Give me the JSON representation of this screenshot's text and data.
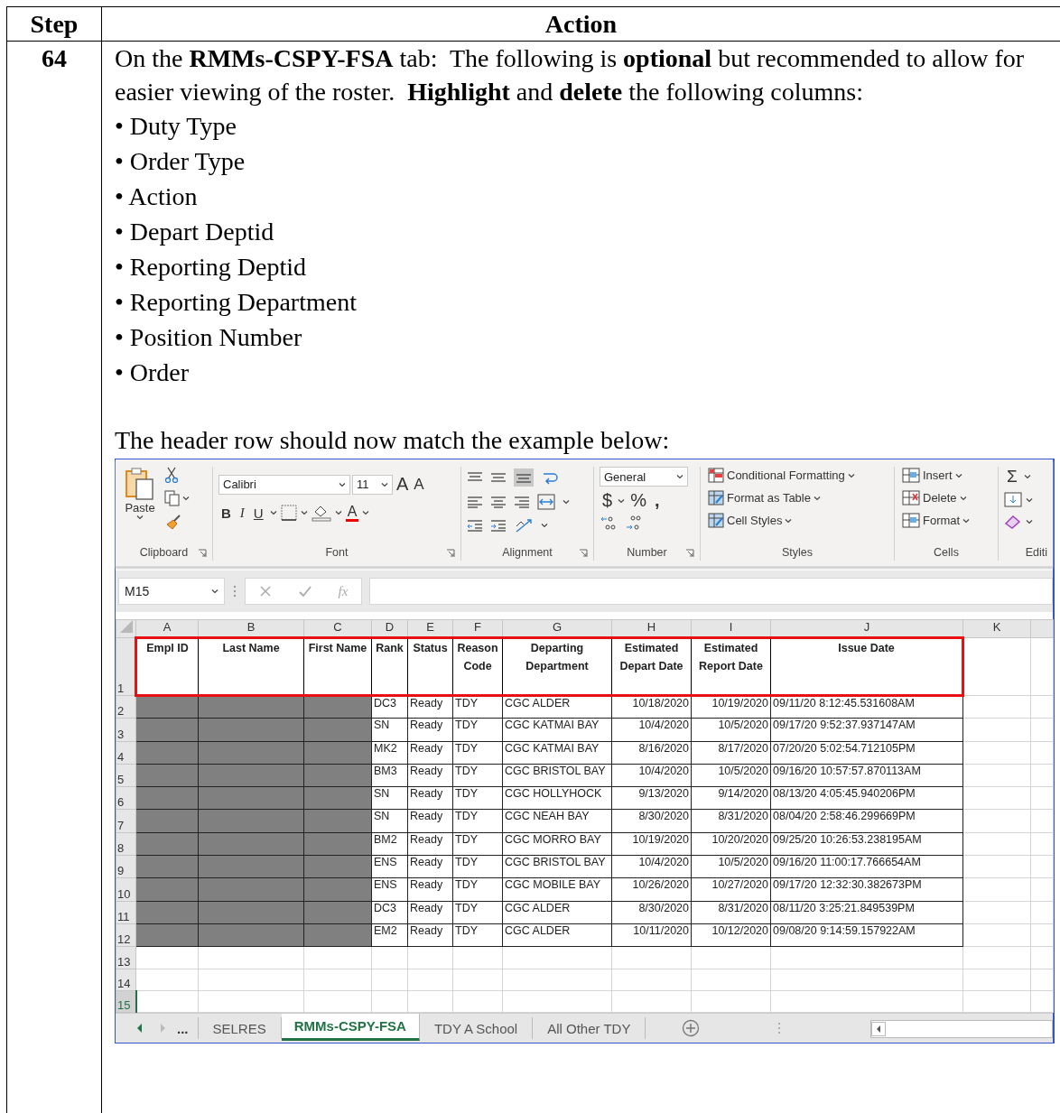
{
  "table": {
    "columns": [
      "Step",
      "Action"
    ]
  },
  "step": {
    "number": "64",
    "instruction": "On the **RMMs-CSPY-FSA** tab:  The following is **optional** but recommended to allow for easier viewing of the roster.  **Highlight** and **delete** the following columns:",
    "columns_to_delete": [
      "• Duty Type",
      "• Order Type",
      "• Action",
      "• Depart Deptid",
      "• Reporting Deptid",
      "• Reporting Department",
      "• Position Number",
      "• Order"
    ],
    "note": "The header row should now match the example below:"
  },
  "excel": {
    "ribbon": {
      "clipboard": {
        "paste": "Paste",
        "label": "Clipboard"
      },
      "font": {
        "name": "Calibri",
        "size": "11",
        "grow": "A",
        "shrink": "A",
        "format_buttons": [
          {
            "label": "B",
            "kind": "bold"
          },
          {
            "label": "I",
            "kind": "italic"
          },
          {
            "label": "U",
            "kind": "underline"
          }
        ],
        "font_color": "A",
        "label": "Font"
      },
      "alignment": {
        "label": "Alignment"
      },
      "number": {
        "format": "General",
        "symbols": [
          "$",
          "%",
          ","
        ],
        "label": "Number"
      },
      "styles": {
        "buttons": [
          "Conditional Formatting",
          "Format as Table",
          "Cell Styles"
        ],
        "label": "Styles"
      },
      "cells": {
        "buttons": [
          "Insert",
          "Delete",
          "Format"
        ],
        "label": "Cells"
      },
      "editing": {
        "sum": "Σ",
        "label": "Editi"
      }
    },
    "name_box": "M15",
    "function_label": "fx",
    "column_letters": [
      "A",
      "B",
      "C",
      "D",
      "E",
      "F",
      "G",
      "H",
      "I",
      "J",
      "K"
    ],
    "header_row": {
      "number": "1",
      "highlighted": true,
      "cells": [
        "Empl ID",
        "Last Name",
        "First Name",
        "Rank",
        "Status",
        "Reason Code",
        "Departing Department",
        "Estimated Depart Date",
        "Estimated Report Date",
        "Issue Date"
      ]
    },
    "rows": [
      {
        "number": "2",
        "redacted": true,
        "active": false,
        "cells": [
          "DC3",
          "Ready",
          "TDY",
          "CGC ALDER",
          "10/18/2020",
          "10/19/2020",
          "09/11/20 8:12:45.531608AM"
        ]
      },
      {
        "number": "3",
        "redacted": true,
        "active": false,
        "cells": [
          "SN",
          "Ready",
          "TDY",
          "CGC KATMAI BAY",
          "10/4/2020",
          "10/5/2020",
          "09/17/20 9:52:37.937147AM"
        ]
      },
      {
        "number": "4",
        "redacted": true,
        "active": false,
        "cells": [
          "MK2",
          "Ready",
          "TDY",
          "CGC KATMAI BAY",
          "8/16/2020",
          "8/17/2020",
          "07/20/20 5:02:54.712105PM"
        ]
      },
      {
        "number": "5",
        "redacted": true,
        "active": false,
        "cells": [
          "BM3",
          "Ready",
          "TDY",
          "CGC BRISTOL BAY",
          "10/4/2020",
          "10/5/2020",
          "09/16/20 10:57:57.870113AM"
        ]
      },
      {
        "number": "6",
        "redacted": true,
        "active": false,
        "cells": [
          "SN",
          "Ready",
          "TDY",
          "CGC HOLLYHOCK",
          "9/13/2020",
          "9/14/2020",
          "08/13/20 4:05:45.940206PM"
        ]
      },
      {
        "number": "7",
        "redacted": true,
        "active": false,
        "cells": [
          "SN",
          "Ready",
          "TDY",
          "CGC NEAH BAY",
          "8/30/2020",
          "8/31/2020",
          "08/04/20 2:58:46.299669PM"
        ]
      },
      {
        "number": "8",
        "redacted": true,
        "active": false,
        "cells": [
          "BM2",
          "Ready",
          "TDY",
          "CGC MORRO BAY",
          "10/19/2020",
          "10/20/2020",
          "09/25/20 10:26:53.238195AM"
        ]
      },
      {
        "number": "9",
        "redacted": true,
        "active": false,
        "cells": [
          "ENS",
          "Ready",
          "TDY",
          "CGC BRISTOL BAY",
          "10/4/2020",
          "10/5/2020",
          "09/16/20 11:00:17.766654AM"
        ]
      },
      {
        "number": "10",
        "redacted": true,
        "active": false,
        "cells": [
          "ENS",
          "Ready",
          "TDY",
          "CGC MOBILE BAY",
          "10/26/2020",
          "10/27/2020",
          "09/17/20 12:32:30.382673PM"
        ]
      },
      {
        "number": "11",
        "redacted": true,
        "active": false,
        "cells": [
          "DC3",
          "Ready",
          "TDY",
          "CGC ALDER",
          "8/30/2020",
          "8/31/2020",
          "08/11/20 3:25:21.849539PM"
        ]
      },
      {
        "number": "12",
        "redacted": true,
        "active": false,
        "cells": [
          "EM2",
          "Ready",
          "TDY",
          "CGC ALDER",
          "10/11/2020",
          "10/12/2020",
          "09/08/20 9:14:59.157922AM"
        ]
      },
      {
        "number": "13",
        "redacted": false,
        "active": false,
        "cells": []
      },
      {
        "number": "14",
        "redacted": false,
        "active": false,
        "cells": []
      },
      {
        "number": "15",
        "redacted": false,
        "active": true,
        "cells": []
      }
    ],
    "more_tabs": "...",
    "sheet_tabs": [
      {
        "label": "SELRES",
        "selected": false
      },
      {
        "label": "RMMs-CSPY-FSA",
        "selected": true
      },
      {
        "label": "TDY A School",
        "selected": false
      },
      {
        "label": "All Other TDY",
        "selected": false
      }
    ]
  }
}
